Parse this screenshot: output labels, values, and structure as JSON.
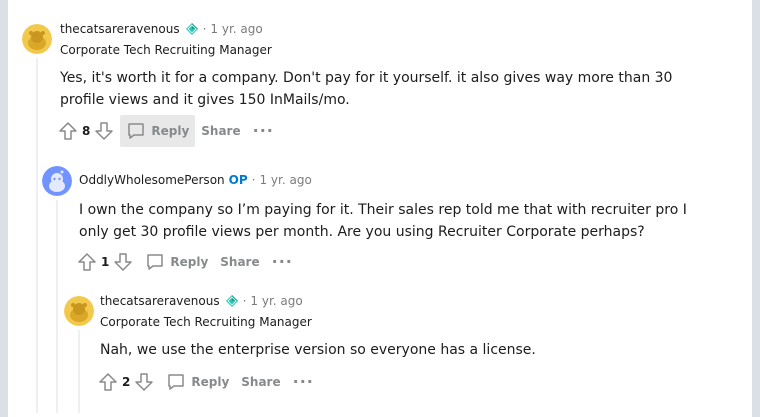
{
  "comments": [
    {
      "author": "thecatsareravenous",
      "op_label": "",
      "separator": "·",
      "time": "1 yr. ago",
      "flair": "Corporate Tech Recruiting Manager",
      "body": "Yes, it's worth it for a company. Don't pay for it yourself. it also gives way more than 30 profile views and it gives 150 InMails/mo.",
      "score": "8",
      "reply_label": "Reply",
      "share_label": "Share",
      "more_label": "···",
      "avatar_color": "#f2c94c"
    },
    {
      "author": "OddlyWholesomePerson",
      "op_label": "OP",
      "separator": "·",
      "time": "1 yr. ago",
      "flair": "",
      "body": "I own the company so I’m paying for it. Their sales rep told me that with recruiter pro I only get 30 profile views per month. Are you using Recruiter Corporate perhaps?",
      "score": "1",
      "reply_label": "Reply",
      "share_label": "Share",
      "more_label": "···",
      "avatar_color": "#7193ff"
    },
    {
      "author": "thecatsareravenous",
      "op_label": "",
      "separator": "·",
      "time": "1 yr. ago",
      "flair": "Corporate Tech Recruiting Manager",
      "body": "Nah, we use the enterprise version so everyone has a license.",
      "score": "2",
      "reply_label": "Reply",
      "share_label": "Share",
      "more_label": "···",
      "avatar_color": "#f2c94c"
    }
  ],
  "icons": {
    "flair": "diamond-flair-icon",
    "upvote": "upvote-arrow-icon",
    "downvote": "downvote-arrow-icon",
    "reply": "speech-bubble-icon"
  }
}
